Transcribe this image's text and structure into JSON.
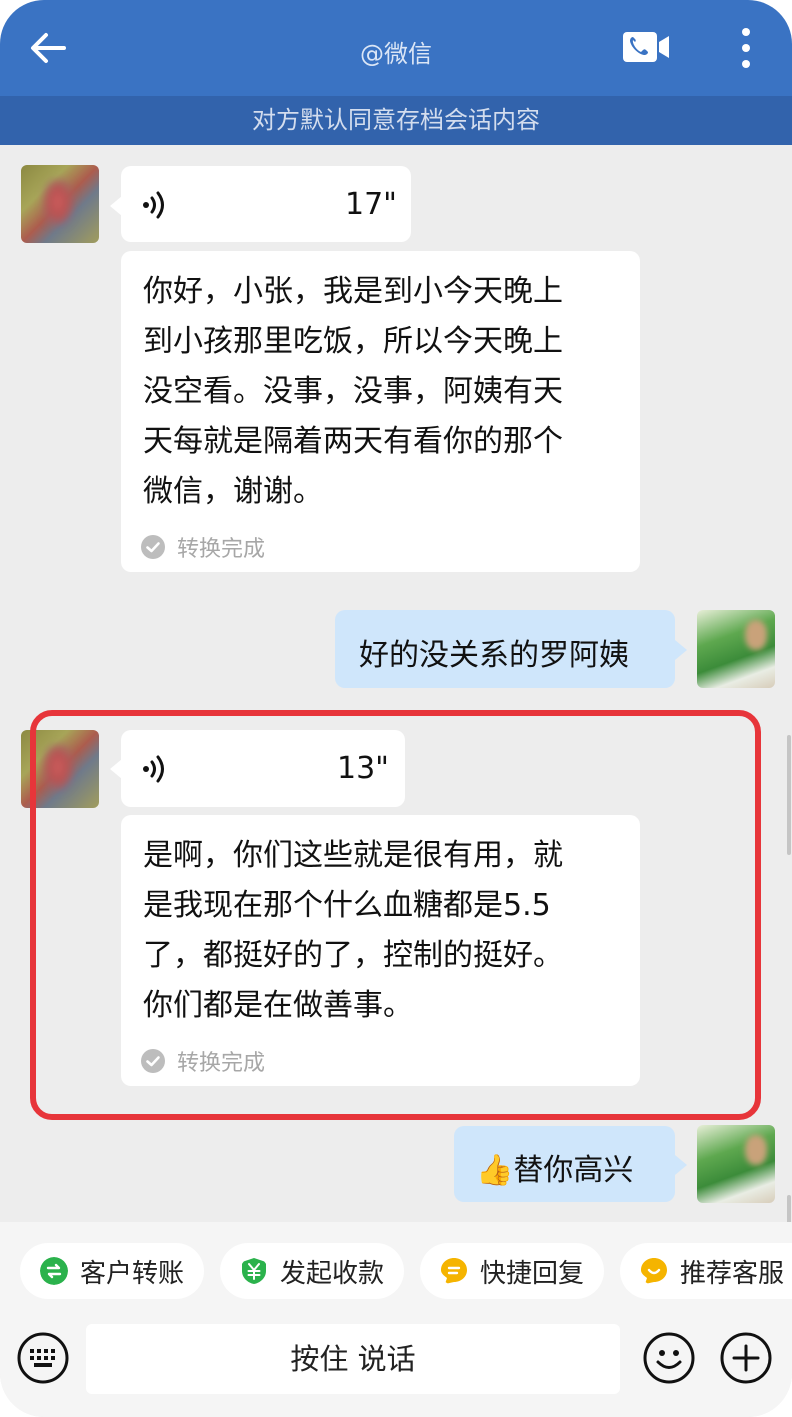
{
  "header": {
    "title": "@微信",
    "notice": "对方默认同意存档会话内容"
  },
  "messages": [
    {
      "sender": "customer",
      "type": "voice",
      "duration": "17\"",
      "transcript": "你好，小张，我是到小今天晚上\n到小孩那里吃饭，所以今天晚上\n没空看。没事，没事，阿姨有天\n天每就是隔着两天有看你的那个\n微信，谢谢。",
      "status": "转换完成"
    },
    {
      "sender": "me",
      "type": "text",
      "text": "好的没关系的罗阿姨"
    },
    {
      "sender": "customer",
      "type": "voice",
      "duration": "13\"",
      "transcript": "是啊，你们这些就是很有用，就\n是我现在那个什么血糖都是5.5\n了，都挺好的了，控制的挺好。\n你们都是在做善事。",
      "status": "转换完成",
      "highlighted": true
    },
    {
      "sender": "me",
      "type": "text",
      "emoji": "👍",
      "text": "替你高兴"
    }
  ],
  "quick_actions": [
    {
      "label": "客户转账",
      "icon": "transfer-icon",
      "color": "#2bb24c"
    },
    {
      "label": "发起收款",
      "icon": "yuan-shield-icon",
      "color": "#2bb24c"
    },
    {
      "label": "快捷回复",
      "icon": "quick-reply-icon",
      "color": "#f5b400"
    },
    {
      "label": "推荐客服",
      "icon": "recommend-icon",
      "color": "#f5b400"
    }
  ],
  "input": {
    "hold_to_talk": "按住 说话"
  },
  "colors": {
    "header": "#3a73c3",
    "notice_bar": "#3263ac",
    "my_bubble": "#cfe6fb",
    "highlight_border": "#e7353a"
  }
}
